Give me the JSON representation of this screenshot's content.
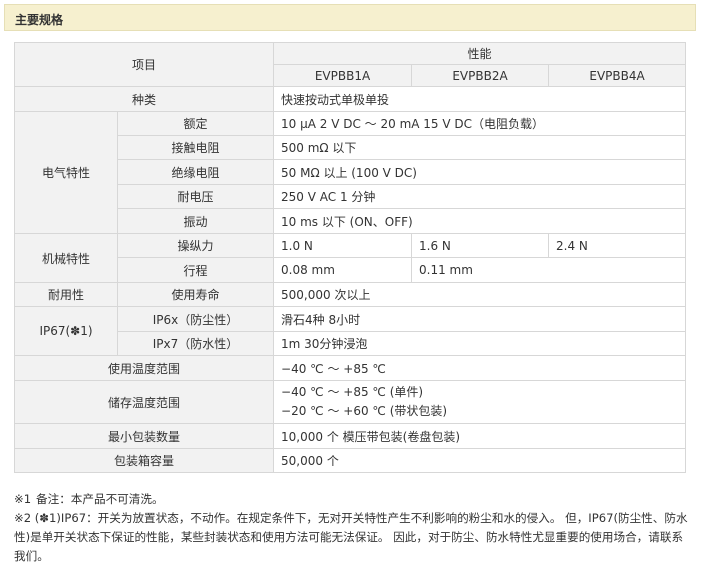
{
  "section_title": "主要规格",
  "table": {
    "col_item": "项目",
    "col_perf": "性能",
    "models": [
      "EVPBB1A",
      "EVPBB2A",
      "EVPBB4A"
    ],
    "type": {
      "label": "种类",
      "value": "快速按动式单极单投"
    },
    "electrical": {
      "group": "电气特性",
      "rows": [
        {
          "label": "额定",
          "value": "10 μA 2 V DC ～ 20 mA 15 V DC（电阻负载）"
        },
        {
          "label": "接触电阻",
          "value": "500 mΩ 以下"
        },
        {
          "label": "绝缘电阻",
          "value": "50 MΩ 以上 (100 V DC)"
        },
        {
          "label": "耐电压",
          "value": "250 V AC 1 分钟"
        },
        {
          "label": "振动",
          "value": "10 ms 以下 (ON、OFF)"
        }
      ]
    },
    "mechanical": {
      "group": "机械特性",
      "force": {
        "label": "操纵力",
        "values": [
          "1.0 N",
          "1.6 N",
          "2.4 N"
        ]
      },
      "travel": {
        "label": "行程",
        "values": [
          "0.08 mm",
          "0.11 mm"
        ]
      }
    },
    "durability": {
      "group": "耐用性",
      "label": "使用寿命",
      "value": "500,000 次以上"
    },
    "ip67": {
      "group": "IP67(✽1)",
      "rows": [
        {
          "label": "IP6x（防尘性）",
          "value": "滑石4种 8小时"
        },
        {
          "label": "IPx7（防水性）",
          "value": "1m 30分钟浸泡"
        }
      ]
    },
    "op_temp": {
      "label": "使用温度范围",
      "value": "−40 ℃ ～ +85 ℃"
    },
    "storage_temp": {
      "label": "储存温度范围",
      "value1": "−40 ℃ ～ +85 ℃ (单件)",
      "value2": "−20 ℃ ～ +60 ℃ (带状包装)"
    },
    "min_pack": {
      "label": "最小包装数量",
      "value": "10,000 个 模压带包装(卷盘包装)"
    },
    "box": {
      "label": "包装箱容量",
      "value": "50,000 个"
    }
  },
  "notes": {
    "n1_mark": "※1",
    "n1_text": "备注：本产品不可清洗。",
    "n2_mark": "※2",
    "n2_text": "(✽1)IP67：开关为放置状态，不动作。在规定条件下，无对开关特性产生不利影响的粉尘和水的侵入。 但，IP67(防尘性、防水性)是单开关状态下保证的性能，某些封装状态和使用方法可能无法保证。 因此，对于防尘、防水特性尤显重要的使用场合，请联系我们。"
  }
}
